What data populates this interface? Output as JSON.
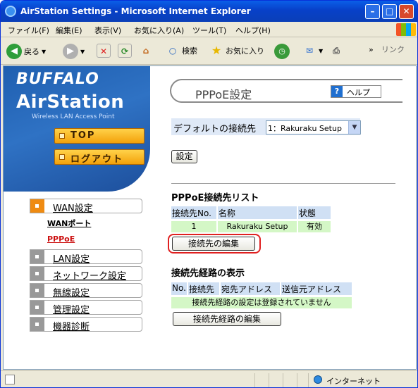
{
  "window": {
    "title": "AirStation Settings - Microsoft Internet Explorer"
  },
  "menubar": {
    "items": [
      "ファイル(F)",
      "編集(E)",
      "表示(V)",
      "お気に入り(A)",
      "ツール(T)",
      "ヘルプ(H)"
    ]
  },
  "toolbar": {
    "back_label": "戻る",
    "search_label": "検索",
    "favorites_label": "お気に入り",
    "links_label": "リンク"
  },
  "sidebar": {
    "brand": "BUFFALO",
    "product": "AirStation",
    "tagline": "Wireless LAN Access Point",
    "top_button": "TOP",
    "logout_button": "ログアウト",
    "nav": [
      {
        "label": "WAN設定",
        "active": true
      },
      {
        "label": "LAN設定"
      },
      {
        "label": "ネットワーク設定"
      },
      {
        "label": "無線設定"
      },
      {
        "label": "管理設定"
      },
      {
        "label": "機器診断"
      }
    ],
    "sub_links": [
      "WANポート",
      "PPPoE"
    ]
  },
  "main": {
    "page_title": "PPPoE設定",
    "help_label": "ヘルプ",
    "default_conn_label": "デフォルトの接続先",
    "default_conn_value": "1：Rakuraku Setup",
    "set_button": "設定",
    "list_heading": "PPPoE接続先リスト",
    "list_headers": [
      "接続先No.",
      "名称",
      "状態"
    ],
    "list_row": [
      "1",
      "Rakuraku Setup",
      "有効"
    ],
    "edit_conn_button": "接続先の編集",
    "route_heading": "接続先経路の表示",
    "route_headers": [
      "No.",
      "接続先",
      "宛先アドレス",
      "送信元アドレス"
    ],
    "route_empty": "接続先経路の設定は登録されていません",
    "edit_route_button": "接続先経路の編集"
  },
  "statusbar": {
    "zone": "インターネット"
  },
  "colors": {
    "highlight": "#e02020",
    "accent": "#ef8b12",
    "brand_blue": "#1f5fb0"
  }
}
